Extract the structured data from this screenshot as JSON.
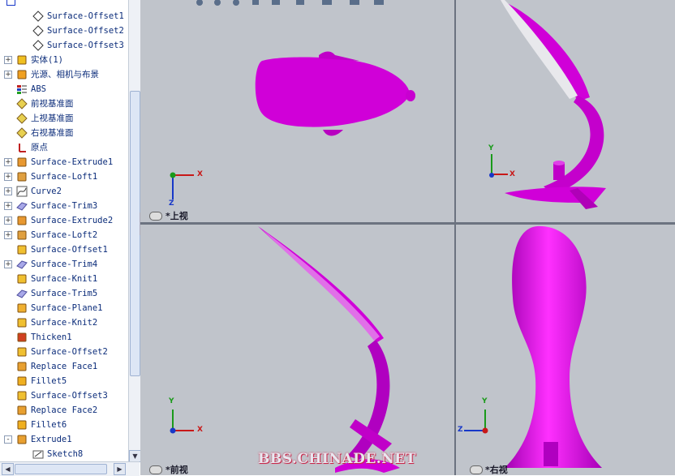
{
  "tree": {
    "items": [
      {
        "label": "Surface-Offset1",
        "icon": "diamond-sketch-icon",
        "indent": 2,
        "expand": ""
      },
      {
        "label": "Surface-Offset2",
        "icon": "diamond-sketch-icon",
        "indent": 2,
        "expand": ""
      },
      {
        "label": "Surface-Offset3",
        "icon": "diamond-sketch-icon",
        "indent": 2,
        "expand": ""
      },
      {
        "label": "实体(1)",
        "icon": "solid-bodies-folder-icon",
        "indent": 1,
        "expand": "+"
      },
      {
        "label": "光源、相机与布景",
        "icon": "lights-cameras-icon",
        "indent": 1,
        "expand": "+"
      },
      {
        "label": "ABS",
        "icon": "material-icon",
        "indent": 1,
        "expand": ""
      },
      {
        "label": "前视基准面",
        "icon": "plane-icon",
        "indent": 1,
        "expand": ""
      },
      {
        "label": "上视基准面",
        "icon": "plane-icon",
        "indent": 1,
        "expand": ""
      },
      {
        "label": "右视基准面",
        "icon": "plane-icon",
        "indent": 1,
        "expand": ""
      },
      {
        "label": "原点",
        "icon": "origin-icon",
        "indent": 1,
        "expand": ""
      },
      {
        "label": "Surface-Extrude1",
        "icon": "surface-extrude-icon",
        "indent": 1,
        "expand": "+"
      },
      {
        "label": "Surface-Loft1",
        "icon": "surface-loft-icon",
        "indent": 1,
        "expand": "+"
      },
      {
        "label": "Curve2",
        "icon": "curve-icon",
        "indent": 1,
        "expand": "+"
      },
      {
        "label": "Surface-Trim3",
        "icon": "surface-trim-icon",
        "indent": 1,
        "expand": "+"
      },
      {
        "label": "Surface-Extrude2",
        "icon": "surface-extrude-icon",
        "indent": 1,
        "expand": "+"
      },
      {
        "label": "Surface-Loft2",
        "icon": "surface-loft-icon",
        "indent": 1,
        "expand": "+"
      },
      {
        "label": "Surface-Offset1",
        "icon": "surface-offset-icon",
        "indent": 1,
        "expand": ""
      },
      {
        "label": "Surface-Trim4",
        "icon": "surface-trim-icon",
        "indent": 1,
        "expand": "+"
      },
      {
        "label": "Surface-Knit1",
        "icon": "surface-knit-icon",
        "indent": 1,
        "expand": ""
      },
      {
        "label": "Surface-Trim5",
        "icon": "surface-trim-icon",
        "indent": 1,
        "expand": ""
      },
      {
        "label": "Surface-Plane1",
        "icon": "surface-plane-icon",
        "indent": 1,
        "expand": ""
      },
      {
        "label": "Surface-Knit2",
        "icon": "surface-knit-icon",
        "indent": 1,
        "expand": ""
      },
      {
        "label": "Thicken1",
        "icon": "thicken-icon",
        "indent": 1,
        "expand": ""
      },
      {
        "label": "Surface-Offset2",
        "icon": "surface-offset-icon",
        "indent": 1,
        "expand": ""
      },
      {
        "label": "Replace Face1",
        "icon": "replace-face-icon",
        "indent": 1,
        "expand": ""
      },
      {
        "label": "Fillet5",
        "icon": "fillet-icon",
        "indent": 1,
        "expand": ""
      },
      {
        "label": "Surface-Offset3",
        "icon": "surface-offset-icon",
        "indent": 1,
        "expand": ""
      },
      {
        "label": "Replace Face2",
        "icon": "replace-face-icon",
        "indent": 1,
        "expand": ""
      },
      {
        "label": "Fillet6",
        "icon": "fillet-icon",
        "indent": 1,
        "expand": ""
      },
      {
        "label": "Extrude1",
        "icon": "extrude-icon",
        "indent": 1,
        "expand": "-"
      },
      {
        "label": "Sketch8",
        "icon": "sketch-icon",
        "indent": 2,
        "expand": ""
      }
    ]
  },
  "viewports": {
    "top": {
      "label": "*上视"
    },
    "front": {
      "label": "*前视"
    },
    "right": {
      "label": "*右视"
    }
  },
  "axes": {
    "x": "X",
    "y": "Y",
    "z": "Z"
  },
  "watermark": "BBS.CHINADE.NET",
  "colors": {
    "model": "#d000d8",
    "viewport_bg": "#c0c4cb",
    "accent": "#0b2c7a"
  }
}
